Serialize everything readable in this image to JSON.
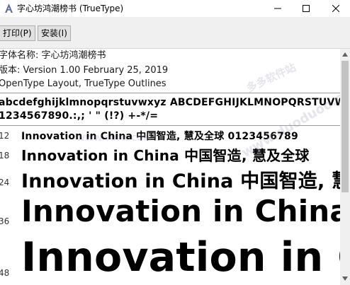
{
  "window": {
    "title": "字心坊鸿潮榜书 (TrueType)",
    "minimize_icon": "minimize-icon",
    "maximize_icon": "maximize-icon",
    "close_icon": "close-icon"
  },
  "toolbar": {
    "print_label": "打印(P)",
    "install_label": "安装(I)"
  },
  "info": {
    "font_name": "字体名称: 字心坊鸿潮榜书",
    "version": "版本: Version 1.00 February 25, 2019",
    "features": "OpenType Layout, TrueType Outlines"
  },
  "charset": {
    "line1": "abcdefghijklmnopqrstuvwxyz ABCDEFGHIJKLMNOPQRSTUVWXYZ",
    "line2": "1234567890.:,; ' \" (!?) +-*/="
  },
  "samples": [
    {
      "size": "12",
      "text": "Innovation in China 中国智造, 慧及全球 0123456789"
    },
    {
      "size": "18",
      "text": "Innovation in China 中国智造, 慧及全球"
    },
    {
      "size": "24",
      "text": "Innovation in China 中国智造, 慧及全"
    },
    {
      "size": "36",
      "text": "Innovation in China"
    },
    {
      "size": "48",
      "text": "Innovation in Ch"
    }
  ],
  "watermarks": {
    "w1": "WWW.9UPK.COM",
    "w2": "多多软件站",
    "w3": "www.duoduoo.com"
  },
  "colors": {
    "toolbar_bg": "#f0f0f0",
    "button_bg": "#e1e1e1",
    "scrollbar_thumb": "#c2c2c2"
  }
}
